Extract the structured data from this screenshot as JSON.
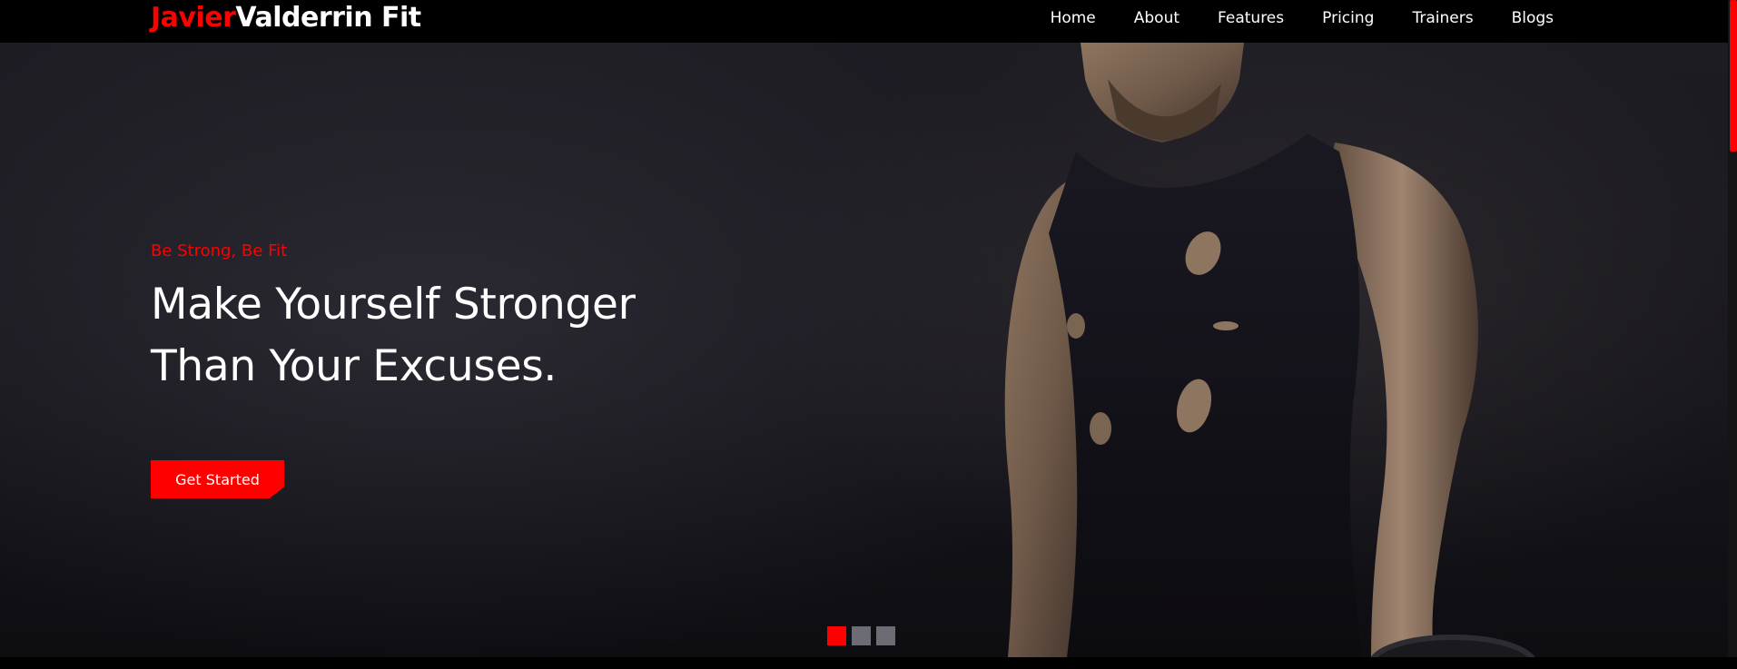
{
  "navbar": {
    "brand_accent": "Javier",
    "brand_rest": "Valderrin Fit",
    "links": [
      "Home",
      "About",
      "Features",
      "Pricing",
      "Trainers",
      "Blogs"
    ]
  },
  "hero": {
    "tagline": "Be Strong, Be Fit",
    "title_line_1": "Make Yourself Stronger",
    "title_line_2": "Than Your Excuses.",
    "cta_label": "Get Started"
  },
  "carousel": {
    "slide_count": 3,
    "active_index": 0
  },
  "colors": {
    "accent": "#ff0000",
    "background": "#000000",
    "text": "#ffffff"
  }
}
